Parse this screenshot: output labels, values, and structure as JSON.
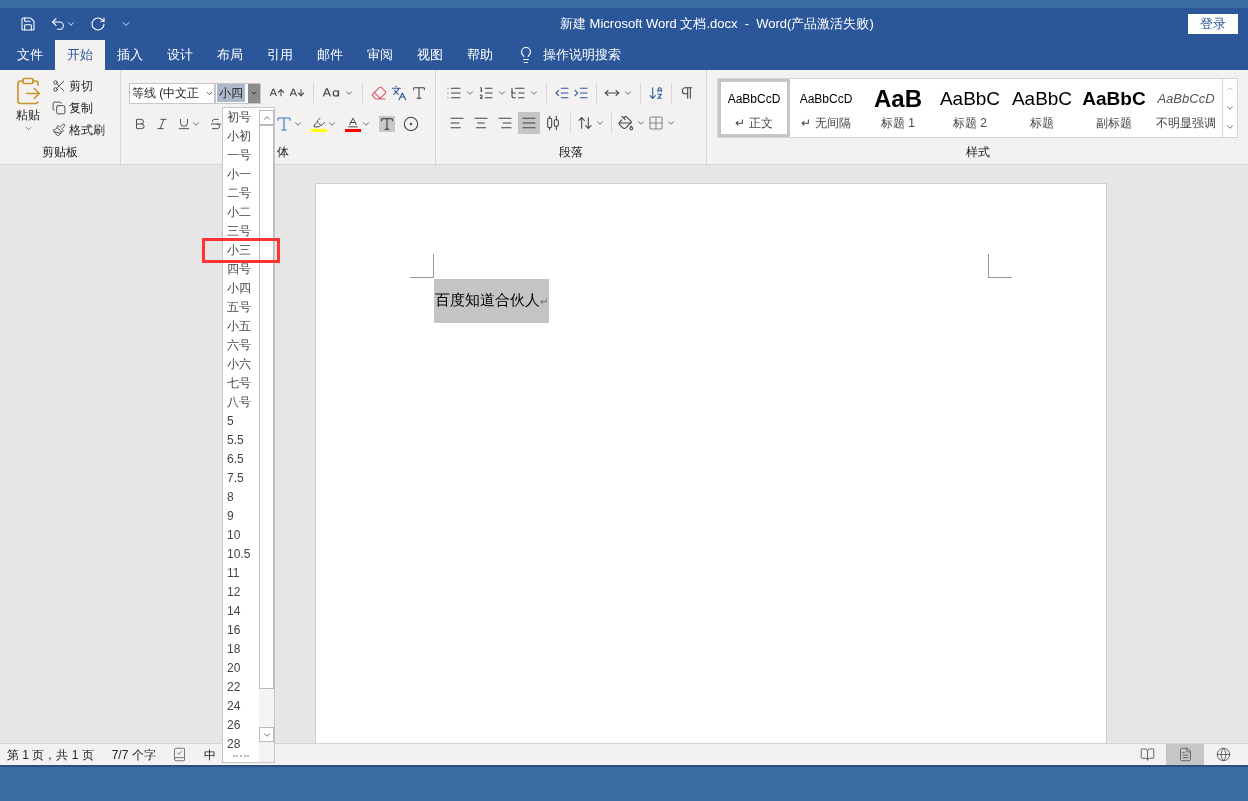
{
  "title": "新建 Microsoft Word 文档.docx  -  Word(产品激活失败)",
  "login_button": "登录",
  "tabs": [
    {
      "label": "文件",
      "selected": false
    },
    {
      "label": "开始",
      "selected": true
    },
    {
      "label": "插入",
      "selected": false
    },
    {
      "label": "设计",
      "selected": false
    },
    {
      "label": "布局",
      "selected": false
    },
    {
      "label": "引用",
      "selected": false
    },
    {
      "label": "邮件",
      "selected": false
    },
    {
      "label": "审阅",
      "selected": false
    },
    {
      "label": "视图",
      "selected": false
    },
    {
      "label": "帮助",
      "selected": false
    }
  ],
  "tell_me": "操作说明搜索",
  "clipboard": {
    "paste": "粘贴",
    "items": [
      "剪切",
      "复制",
      "格式刷"
    ],
    "label": "剪贴板"
  },
  "font": {
    "name": "等线 (中文正",
    "size": "小四",
    "label": "体"
  },
  "paragraph": {
    "label": "段落",
    "alignments": [
      {
        "selected": false
      },
      {
        "selected": false
      },
      {
        "selected": false
      },
      {
        "selected": true
      },
      {
        "selected": false
      }
    ]
  },
  "styles": {
    "label": "样式",
    "items": [
      {
        "kind": "normal",
        "preview": "AaBbCcD",
        "name": "↵ 正文",
        "selected": true
      },
      {
        "kind": "normal",
        "preview": "AaBbCcD",
        "name": "↵ 无间隔",
        "selected": false
      },
      {
        "kind": "heading1",
        "preview": "AaB",
        "name": "标题 1",
        "selected": false
      },
      {
        "kind": "heading2",
        "preview": "AaBbC",
        "name": "标题 2",
        "selected": false
      },
      {
        "kind": "title",
        "preview": "AaBbC",
        "name": "标题",
        "selected": false
      },
      {
        "kind": "subtitle",
        "preview": "AaBbC",
        "name": "副标题",
        "selected": false
      },
      {
        "kind": "emphasis",
        "preview": "AaBbCcD",
        "name": "不明显强调",
        "selected": false
      }
    ]
  },
  "size_dropdown": {
    "items": [
      {
        "label": "初号",
        "highlighted": false
      },
      {
        "label": "小初",
        "highlighted": false
      },
      {
        "label": "一号",
        "highlighted": false
      },
      {
        "label": "小一",
        "highlighted": false
      },
      {
        "label": "二号",
        "highlighted": false
      },
      {
        "label": "小二",
        "highlighted": false
      },
      {
        "label": "三号",
        "highlighted": false
      },
      {
        "label": "小三",
        "highlighted": true
      },
      {
        "label": "四号",
        "highlighted": false
      },
      {
        "label": "小四",
        "highlighted": false
      },
      {
        "label": "五号",
        "highlighted": false
      },
      {
        "label": "小五",
        "highlighted": false
      },
      {
        "label": "六号",
        "highlighted": false
      },
      {
        "label": "小六",
        "highlighted": false
      },
      {
        "label": "七号",
        "highlighted": false
      },
      {
        "label": "八号",
        "highlighted": false
      },
      {
        "label": "5",
        "highlighted": false
      },
      {
        "label": "5.5",
        "highlighted": false
      },
      {
        "label": "6.5",
        "highlighted": false
      },
      {
        "label": "7.5",
        "highlighted": false
      },
      {
        "label": "8",
        "highlighted": false
      },
      {
        "label": "9",
        "highlighted": false
      },
      {
        "label": "10",
        "highlighted": false
      },
      {
        "label": "10.5",
        "highlighted": false
      },
      {
        "label": "11",
        "highlighted": false
      },
      {
        "label": "12",
        "highlighted": false
      },
      {
        "label": "14",
        "highlighted": false
      },
      {
        "label": "16",
        "highlighted": false
      },
      {
        "label": "18",
        "highlighted": false
      },
      {
        "label": "20",
        "highlighted": false
      },
      {
        "label": "22",
        "highlighted": false
      },
      {
        "label": "24",
        "highlighted": false
      },
      {
        "label": "26",
        "highlighted": false
      },
      {
        "label": "28",
        "highlighted": false
      }
    ]
  },
  "document": {
    "text": "百度知道合伙人",
    "mark": "↵",
    "selected": true
  },
  "status_bar": {
    "page": "第 1 页，共 1 页",
    "words": "7/7 个字",
    "language": "中",
    "views": [
      {
        "selected": false
      },
      {
        "selected": true
      },
      {
        "selected": false
      }
    ]
  }
}
